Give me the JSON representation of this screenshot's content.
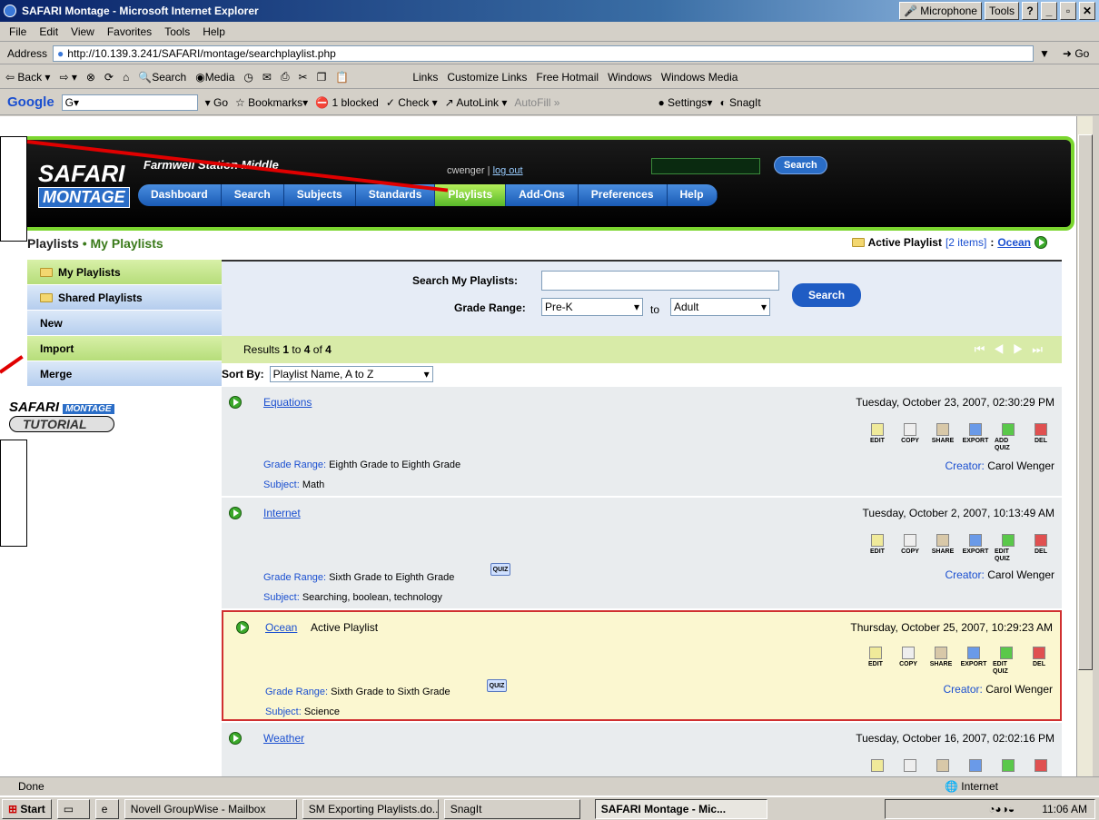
{
  "window": {
    "title": "SAFARI Montage - Microsoft Internet Explorer",
    "microphone": "Microphone",
    "tools": "Tools",
    "help_btn": "?"
  },
  "menu": [
    "File",
    "Edit",
    "View",
    "Favorites",
    "Tools",
    "Help"
  ],
  "address": {
    "label": "Address",
    "url": "http://10.139.3.241/SAFARI/montage/searchplaylist.php",
    "go": "Go"
  },
  "nav": {
    "back": "Back",
    "search": "Search",
    "media": "Media",
    "links": "Links",
    "items": [
      "Customize Links",
      "Free Hotmail",
      "Windows",
      "Windows Media"
    ]
  },
  "google": {
    "go": "Go",
    "bookmarks": "Bookmarks",
    "blocked": "1 blocked",
    "check": "Check",
    "autolink": "AutoLink",
    "autofill": "AutoFill",
    "settings": "Settings",
    "snagit": "SnagIt"
  },
  "site": {
    "logo1": "SAFARI",
    "logo2": "MONTAGE",
    "school": "Farmwell Station Middle",
    "user": "cwenger",
    "logout": "log out",
    "search_btn": "Search",
    "tabs": [
      "Dashboard",
      "Search",
      "Subjects",
      "Standards",
      "Playlists",
      "Add-Ons",
      "Preferences",
      "Help"
    ]
  },
  "breadcrumb": {
    "main": "Playlists",
    "sub": "My Playlists"
  },
  "active_playlist": {
    "label": "Active Playlist",
    "count": "[2 items]",
    "sep": ":",
    "name": "Ocean"
  },
  "sidebar": {
    "items": [
      "My Playlists",
      "Shared Playlists",
      "New",
      "Import",
      "Merge"
    ],
    "tutorial_1": "SAFARI",
    "tutorial_2": "MONTAGE",
    "tutorial_3": "TUTORIAL"
  },
  "search": {
    "label": "Search My Playlists:",
    "value": "",
    "grade_label": "Grade Range:",
    "from": "Pre-K",
    "to_word": "to",
    "to": "Adult",
    "button": "Search"
  },
  "results": {
    "prefix": "Results",
    "from": "1",
    "to_word": "to",
    "to": "4",
    "of_word": "of",
    "total": "4"
  },
  "sort": {
    "label": "Sort By:",
    "value": "Playlist Name, A to Z"
  },
  "icon_labels": {
    "edit": "EDIT",
    "copy": "COPY",
    "share": "SHARE",
    "export": "EXPORT",
    "del": "DEL"
  },
  "playlists": [
    {
      "name": "Equations",
      "date": "Tuesday, October 23, 2007, 02:30:29 PM",
      "grade_label": "Grade Range:",
      "grade": "Eighth Grade to Eighth Grade",
      "subject_label": "Subject:",
      "subject": "Math",
      "creator_label": "Creator:",
      "creator": "Carol Wenger",
      "quiz_action": "ADD QUIZ"
    },
    {
      "name": "Internet",
      "date": "Tuesday, October 2, 2007, 10:13:49 AM",
      "grade_label": "Grade Range:",
      "grade": "Sixth Grade to Eighth Grade",
      "subject_label": "Subject:",
      "subject": "Searching, boolean, technology",
      "creator_label": "Creator:",
      "creator": "Carol Wenger",
      "quiz_action": "EDIT QUIZ",
      "badge": "QUIZ"
    },
    {
      "name": "Ocean",
      "active_label": "Active Playlist",
      "date": "Thursday, October 25, 2007, 10:29:23 AM",
      "grade_label": "Grade Range:",
      "grade": "Sixth Grade to Sixth Grade",
      "subject_label": "Subject:",
      "subject": "Science",
      "creator_label": "Creator:",
      "creator": "Carol Wenger",
      "quiz_action": "EDIT QUIZ",
      "badge": "QUIZ"
    },
    {
      "name": "Weather",
      "date": "Tuesday, October 16, 2007, 02:02:16 PM"
    }
  ],
  "status": {
    "text": "Done",
    "zone": "Internet"
  },
  "taskbar": {
    "start": "Start",
    "tasks": [
      "Novell GroupWise - Mailbox",
      "SM Exporting Playlists.do...",
      "SnagIt",
      "SAFARI Montage - Mic..."
    ],
    "clock": "11:06 AM"
  },
  "colors": {
    "accent_green": "#7bd62f",
    "nav_blue": "#2a6dc7",
    "arrow_red": "#e00000"
  }
}
